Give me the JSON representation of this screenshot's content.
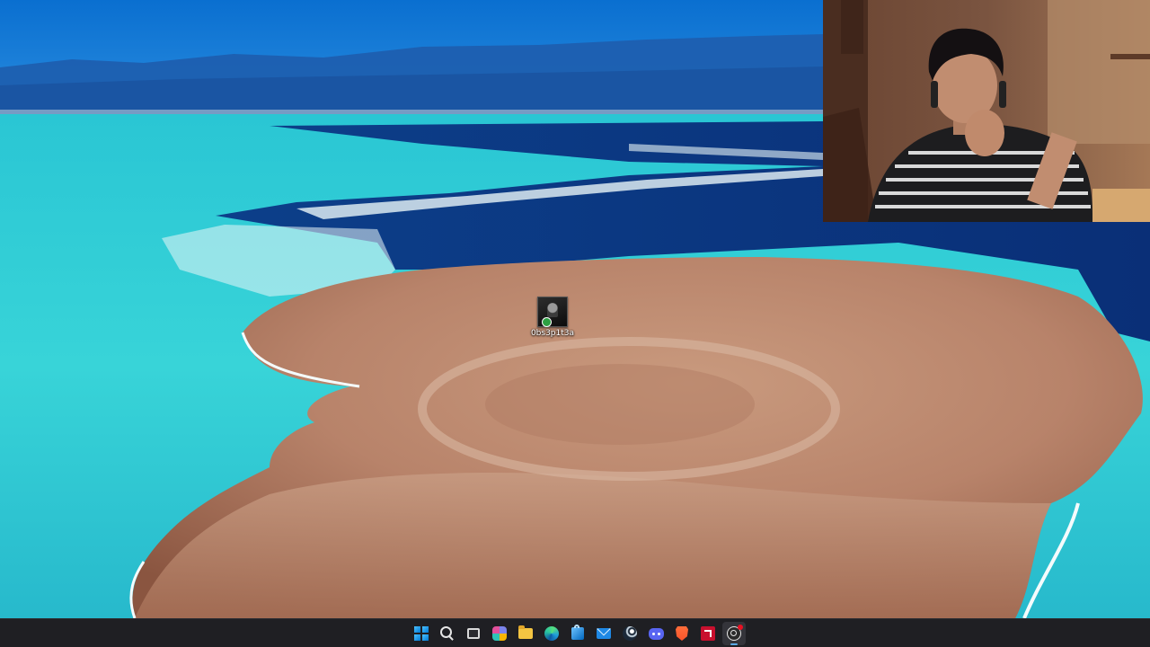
{
  "desktop": {
    "wallpaper_icon": "island-landscape-wallpaper",
    "icons": [
      {
        "label": "0bs3p1t3a",
        "icon": "dark-thumbnail-file-icon",
        "status_icon": "sync-check-icon"
      }
    ]
  },
  "webcam": {
    "icon": "webcam-person-feed"
  },
  "taskbar": {
    "background": "#1f1f23",
    "items": [
      {
        "name": "start",
        "icon": "windows-logo-icon"
      },
      {
        "name": "search",
        "icon": "search-icon"
      },
      {
        "name": "task-view",
        "icon": "task-view-icon"
      },
      {
        "name": "teams",
        "icon": "teams-icon"
      },
      {
        "name": "file-explorer",
        "icon": "folder-icon"
      },
      {
        "name": "edge",
        "icon": "edge-icon"
      },
      {
        "name": "microsoft-store",
        "icon": "store-icon"
      },
      {
        "name": "mail",
        "icon": "mail-icon"
      },
      {
        "name": "steam",
        "icon": "steam-icon"
      },
      {
        "name": "discord",
        "icon": "discord-icon"
      },
      {
        "name": "brave",
        "icon": "brave-icon"
      },
      {
        "name": "amd-software",
        "icon": "amd-icon"
      },
      {
        "name": "obs-studio",
        "icon": "obs-icon",
        "active": true,
        "recording": true
      }
    ]
  }
}
